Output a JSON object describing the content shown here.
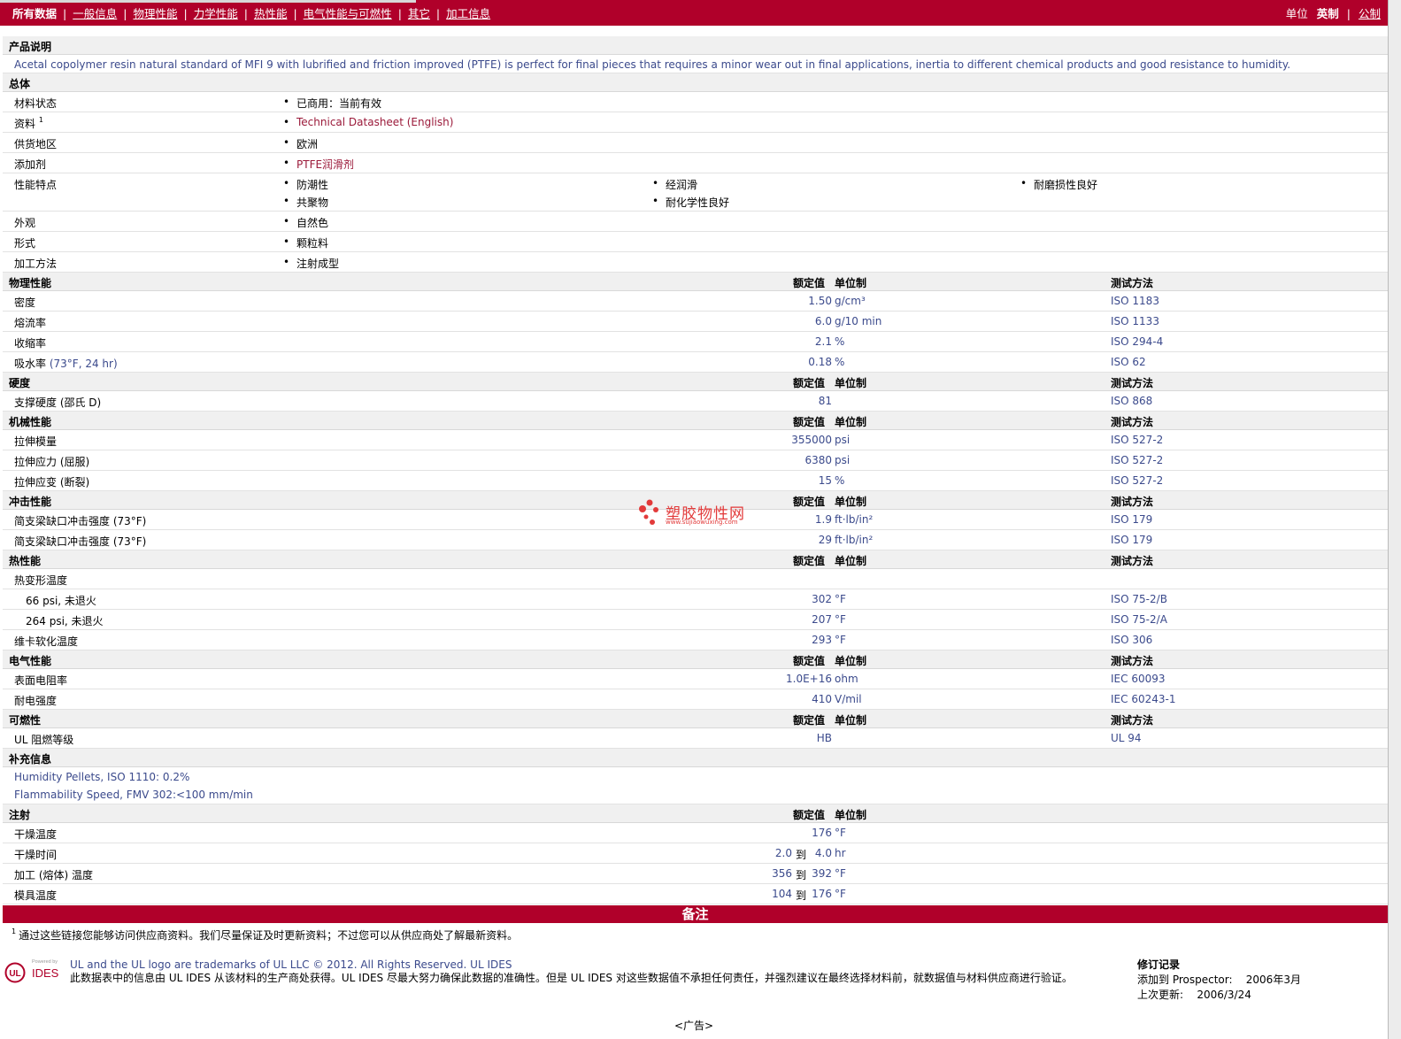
{
  "nav": {
    "tabs": [
      {
        "label": "所有数据",
        "current": true
      },
      {
        "label": "一般信息"
      },
      {
        "label": "物理性能"
      },
      {
        "label": "力学性能"
      },
      {
        "label": "热性能"
      },
      {
        "label": "电气性能与可燃性"
      },
      {
        "label": "其它"
      },
      {
        "label": "加工信息"
      }
    ],
    "units_label": "单位",
    "units_selected": "英制",
    "units_other": "公制",
    "bar_color": "#b0002a"
  },
  "headers": {
    "nominal": "额定值",
    "unit": "单位制",
    "test": "测试方法"
  },
  "product": {
    "title": "产品说明",
    "description": "Acetal copolymer resin natural standard of MFI 9 with lubrified and friction improved (PTFE) is perfect for final pieces that requires a minor wear out in final applications, inertia to different chemical products and good resistance to humidity."
  },
  "general": {
    "title": "总体",
    "rows": [
      {
        "label": "材料状态",
        "values": [
          "已商用：当前有效"
        ]
      },
      {
        "label": "资料",
        "sup": "1",
        "values": [
          "Technical Datasheet (English)"
        ],
        "link": true
      },
      {
        "label": "供货地区",
        "values": [
          "欧洲"
        ]
      },
      {
        "label": "添加剂",
        "values": [
          "PTFE润滑剂"
        ],
        "link": true
      },
      {
        "label": "性能特点",
        "values": [
          "防潮性",
          "经润滑",
          "耐磨损性良好",
          "共聚物",
          "耐化学性良好"
        ]
      },
      {
        "label": "外观",
        "values": [
          "自然色"
        ]
      },
      {
        "label": "形式",
        "values": [
          "颗粒料"
        ]
      },
      {
        "label": "加工方法",
        "values": [
          "注射成型"
        ]
      }
    ]
  },
  "physical": {
    "title": "物理性能",
    "rows": [
      {
        "label": "密度",
        "value": "1.50",
        "unit": "g/cm³",
        "test": "ISO 1183"
      },
      {
        "label": "熔流率",
        "value": "6.0",
        "unit": "g/10 min",
        "test": "ISO 1133"
      },
      {
        "label": "收缩率",
        "value": "2.1",
        "unit": "%",
        "test": "ISO 294-4"
      },
      {
        "label": "吸水率",
        "cond": "(73°F, 24 hr)",
        "value": "0.18",
        "unit": "%",
        "test": "ISO 62"
      }
    ]
  },
  "hardness": {
    "title": "硬度",
    "rows": [
      {
        "label": "支撑硬度 (邵氏 D)",
        "value": "81",
        "unit": "",
        "test": "ISO 868"
      }
    ]
  },
  "mechanical": {
    "title": "机械性能",
    "rows": [
      {
        "label": "拉伸模量",
        "value": "355000",
        "unit": "psi",
        "test": "ISO 527-2"
      },
      {
        "label": "拉伸应力 (屈服)",
        "value": "6380",
        "unit": "psi",
        "test": "ISO 527-2"
      },
      {
        "label": "拉伸应变 (断裂)",
        "value": "15",
        "unit": "%",
        "test": "ISO 527-2"
      }
    ]
  },
  "impact": {
    "title": "冲击性能",
    "rows": [
      {
        "label": "简支梁缺口冲击强度 (73°F)",
        "value": "1.9",
        "unit": "ft·lb/in²",
        "test": "ISO 179"
      },
      {
        "label": "简支梁缺口冲击强度 (73°F)",
        "value": "29",
        "unit": "ft·lb/in²",
        "test": "ISO 179"
      }
    ]
  },
  "thermal": {
    "title": "热性能",
    "group_label": "热变形温度",
    "rows": [
      {
        "label": "66 psi, 未退火",
        "value": "302",
        "unit": "°F",
        "test": "ISO 75-2/B"
      },
      {
        "label": "264 psi, 未退火",
        "value": "207",
        "unit": "°F",
        "test": "ISO 75-2/A"
      },
      {
        "label": "维卡软化温度",
        "value": "293",
        "unit": "°F",
        "test": "ISO 306"
      }
    ]
  },
  "electrical": {
    "title": "电气性能",
    "rows": [
      {
        "label": "表面电阻率",
        "value": "1.0E+16",
        "unit": "ohm",
        "test": "IEC 60093"
      },
      {
        "label": "耐电强度",
        "value": "410",
        "unit": "V/mil",
        "test": "IEC 60243-1"
      }
    ]
  },
  "flammability": {
    "title": "可燃性",
    "rows": [
      {
        "label": "UL 阻燃等级",
        "value": "HB",
        "unit": "",
        "test": "UL 94"
      }
    ]
  },
  "supplement": {
    "title": "补充信息",
    "lines": [
      "Humidity Pellets, ISO 1110: 0.2%",
      "Flammability Speed, FMV 302:<100 mm/min"
    ]
  },
  "injection": {
    "title": "注射",
    "to_word": "到",
    "rows": [
      {
        "label": "干燥温度",
        "value": "176",
        "unit": "°F"
      },
      {
        "label": "干燥时间",
        "low": "2.0",
        "high": "4.0",
        "unit": "hr"
      },
      {
        "label": "加工 (熔体) 温度",
        "low": "356",
        "high": "392",
        "unit": "°F"
      },
      {
        "label": "模具温度",
        "low": "104",
        "high": "176",
        "unit": "°F"
      }
    ]
  },
  "remarks": {
    "title": "备注",
    "note_num": "1",
    "note": "通过这些链接您能够访问供应商资料。我们尽量保证及时更新资料；不过您可以从供应商处了解最新资料。"
  },
  "footer": {
    "logo_powered": "Powered by",
    "logo_ul": "UL",
    "logo_ides": "IDES",
    "line1": "UL and the UL logo are trademarks of UL LLC © 2012. All Rights Reserved. UL IDES",
    "line2": "此数据表中的信息由 UL IDES 从该材料的生产商处获得。UL IDES 尽最大努力确保此数据的准确性。但是 UL IDES 对这些数据值不承担任何责任，并强烈建议在最终选择材料前，就数据值与材料供应商进行验证。",
    "rev_title": "修订记录",
    "rev_added_label": "添加到 Prospector:",
    "rev_added_value": "2006年3月",
    "rev_updated_label": "上次更新:",
    "rev_updated_value": "2006/3/24",
    "ad": "<广告>"
  },
  "watermark": {
    "text": "塑胶物性网",
    "url": "www.sujiaowuxing.com"
  }
}
